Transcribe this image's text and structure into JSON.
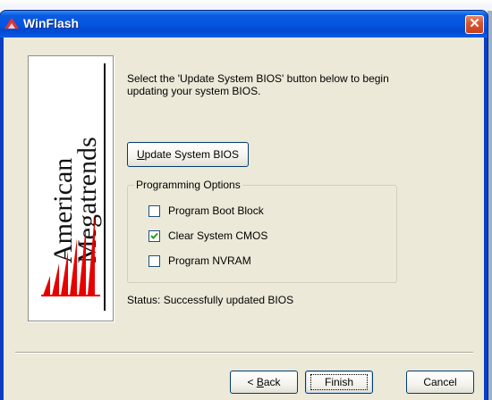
{
  "window": {
    "title": "WinFlash",
    "close_symbol": "✕"
  },
  "logo": {
    "line1": "American",
    "line2": "Megatrends"
  },
  "instructions": "Select the 'Update System BIOS' button below to begin updating your system BIOS.",
  "update_button": {
    "label_accel": "U",
    "label_rest": "pdate System BIOS"
  },
  "programming_options": {
    "title": "Programming Options",
    "items": [
      {
        "label": "Program Boot Block",
        "checked": false
      },
      {
        "label": "Clear System CMOS",
        "checked": true
      },
      {
        "label": "Program NVRAM",
        "checked": false
      }
    ]
  },
  "status": "Status: Successfully updated BIOS",
  "buttons": {
    "back_prefix": "< ",
    "back_accel": "B",
    "back_rest": "ack",
    "finish": "Finish",
    "cancel": "Cancel"
  },
  "colors": {
    "titlebar": "#0456e0",
    "close": "#d8532e",
    "dialog_bg": "#ece9d8",
    "logo_red": "#e60000",
    "check_mark": "#21a121"
  },
  "icons": {
    "app": "winflash-app-icon",
    "close": "close-icon",
    "logo": "ami-logo-icon",
    "check": "check-icon"
  }
}
